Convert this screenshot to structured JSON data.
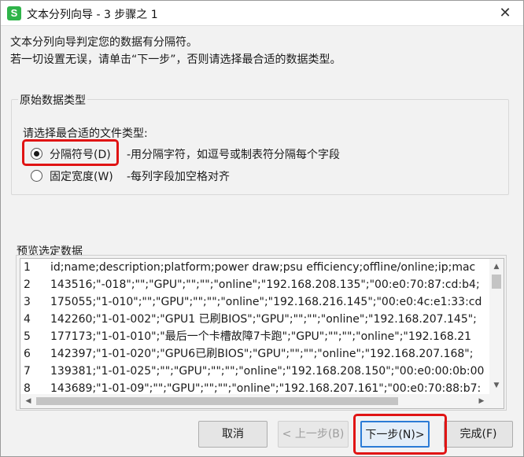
{
  "window": {
    "title": "文本分列向导 - 3 步骤之 1",
    "app_icon": "S",
    "close_glyph": "✕"
  },
  "intro": {
    "line1": "文本分列向导判定您的数据有分隔符。",
    "line2": "若一切设置无误，请单击“下一步”，否则请选择最合适的数据类型。"
  },
  "original_type": {
    "group_title": "原始数据类型",
    "prompt": "请选择最合适的文件类型:",
    "options": [
      {
        "label": "分隔符号(D)",
        "description": "-用分隔字符，如逗号或制表符分隔每个字段",
        "checked": true
      },
      {
        "label": "固定宽度(W)",
        "description": "-每列字段加空格对齐",
        "checked": false
      }
    ]
  },
  "preview": {
    "label": "预览选定数据",
    "rows": [
      {
        "num": "1",
        "text": "id;name;description;platform;power draw;psu efficiency;offline/online;ip;mac"
      },
      {
        "num": "2",
        "text": "143516;\"-018\";\"\";\"GPU\";\"\";\"\";\"online\";\"192.168.208.135\";\"00:e0:70:87:cd:b4;"
      },
      {
        "num": "3",
        "text": "175055;\"1-010\";\"\";\"GPU\";\"\";\"\";\"online\";\"192.168.216.145\";\"00:e0:4c:e1:33:cd"
      },
      {
        "num": "4",
        "text": "142260;\"1-01-002\";\"GPU1 已刷BIOS\";\"GPU\";\"\";\"\";\"online\";\"192.168.207.145\";"
      },
      {
        "num": "5",
        "text": "177173;\"1-01-010\";\"最后一个卡槽故障7卡跑\";\"GPU\";\"\";\"\";\"online\";\"192.168.21"
      },
      {
        "num": "6",
        "text": "142397;\"1-01-020\";\"GPU6已刷BIOS\";\"GPU\";\"\";\"\";\"online\";\"192.168.207.168\";"
      },
      {
        "num": "7",
        "text": "139381;\"1-01-025\";\"\";\"GPU\";\"\";\"\";\"online\";\"192.168.208.150\";\"00:e0:00:0b:00"
      },
      {
        "num": "8",
        "text": "143689;\"1-01-09\";\"\";\"GPU\";\"\";\"\";\"online\";\"192.168.207.161\";\"00:e0:70:88:b7:"
      }
    ]
  },
  "buttons": {
    "cancel": "取消",
    "prev": "< 上一步(B)",
    "next": "下一步(N)>",
    "finish": "完成(F)"
  },
  "colors": {
    "highlight": "#e01414",
    "primary_border": "#2b7bd6",
    "app_icon": "#2fb44a"
  }
}
